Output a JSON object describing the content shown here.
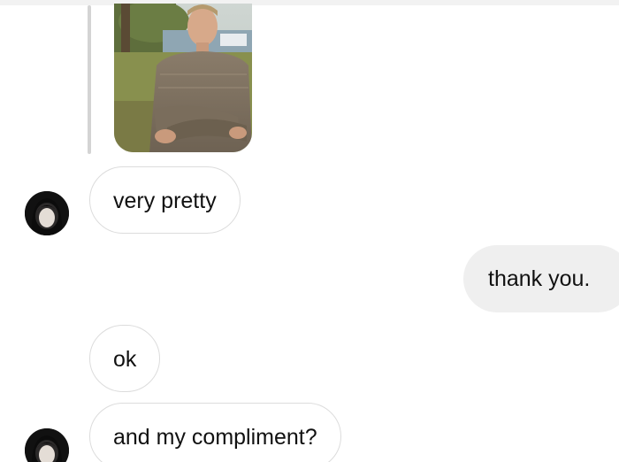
{
  "chat": {
    "shared_photo": {
      "description_icon": "photo-thumbnail-icon"
    },
    "messages": [
      {
        "id": "m1",
        "from": "them",
        "text": "very pretty",
        "show_avatar": true
      },
      {
        "id": "m2",
        "from": "me",
        "text": "thank you."
      },
      {
        "id": "m3",
        "from": "them",
        "text": "ok",
        "show_avatar": false
      },
      {
        "id": "m4",
        "from": "them",
        "text": "and my compliment?",
        "show_avatar": true
      }
    ]
  },
  "colors": {
    "received_bubble_border": "#dcdcdc",
    "sent_bubble_bg": "#efefef",
    "reply_line": "#d4d4d4",
    "text": "#111111"
  }
}
